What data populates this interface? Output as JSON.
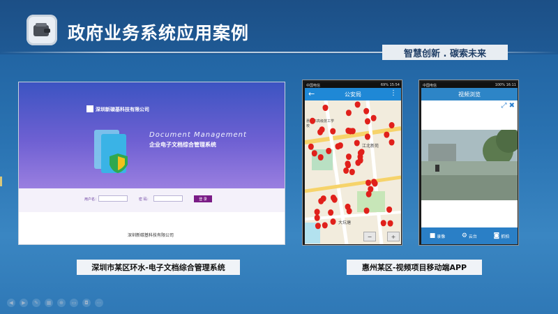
{
  "header": {
    "title": "政府业务系统应用案例",
    "slogan": "智慧创新 . 碳索未来",
    "logo_icon": "wallet-icon"
  },
  "left_screenshot": {
    "company_top": "深圳新碳基科技有限公司",
    "en_title": "Document Management",
    "cn_title": "企业电子文档综合管理系统",
    "username_label": "用户名：",
    "password_label": "密 码：",
    "login_button": "登 录",
    "company_bottom": "深圳新碳基科技有限公司"
  },
  "phone_police": {
    "carrier": "中国电信",
    "battery": "69%",
    "time": "15:54",
    "title": "公安局",
    "map_labels": [
      "江北新苑",
      "大坑塘",
      "惠州市高级技工学校"
    ],
    "zoom_out": "−",
    "zoom_in": "+"
  },
  "phone_video": {
    "carrier": "中国电信",
    "battery": "100%",
    "time": "16:11",
    "title": "视频浏览",
    "tabs": [
      {
        "label": "录像",
        "icon": "video-camera-icon"
      },
      {
        "label": "云台",
        "icon": "gear-icon"
      },
      {
        "label": "抓拍",
        "icon": "camera-icon"
      }
    ]
  },
  "captions": {
    "left": "深圳市某区环水-电子文档综合管理系统",
    "right": "惠州某区-视频项目移动端APP"
  },
  "colors": {
    "background": "#2a73b2",
    "appbar": "#1f88d6",
    "login_button": "#7a1c86"
  }
}
